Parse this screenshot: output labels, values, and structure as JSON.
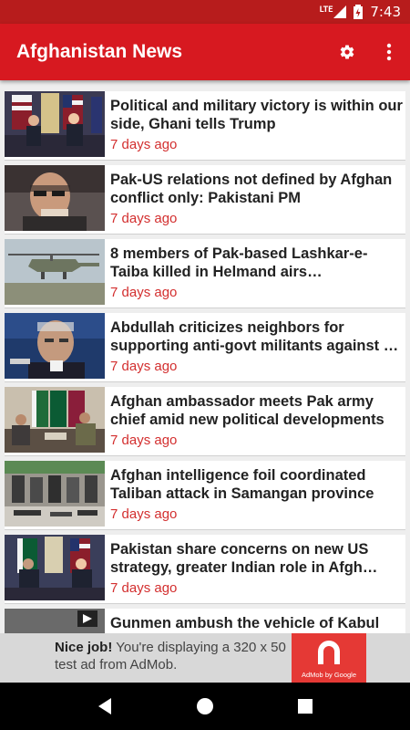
{
  "status_bar": {
    "network": "LTE",
    "time": "7:43"
  },
  "app_bar": {
    "title": "Afghanistan News",
    "settings_icon": "gear-icon",
    "menu_icon": "more-vert-icon"
  },
  "articles": [
    {
      "headline": "Political and military victory is within our side, Ghani tells Trump",
      "age": "7 days ago"
    },
    {
      "headline": "Pak-US relations not defined by Afghan conflict only: Pakistani PM",
      "age": "7 days ago"
    },
    {
      "headline": "8 members of Pak-based Lashkar-e-Taiba killed in Helmand airs…",
      "age": "7 days ago"
    },
    {
      "headline": "Abdullah criticizes neighbors for supporting anti-govt militants against …",
      "age": "7 days ago"
    },
    {
      "headline": "Afghan ambassador meets Pak army chief amid new political developments",
      "age": "7 days ago"
    },
    {
      "headline": "Afghan intelligence foil coordinated Taliban attack in Samangan province",
      "age": "7 days ago"
    },
    {
      "headline": "Pakistan share concerns on new US strategy, greater Indian role in Afgh…",
      "age": "7 days ago"
    },
    {
      "headline": "Gunmen ambush the vehicle of Kabul",
      "age": ""
    }
  ],
  "ad": {
    "bold": "Nice job!",
    "text": " You're displaying a 320 x 50 test ad from AdMob.",
    "logo_label": "AdMob by Google"
  },
  "colors": {
    "primary": "#d71920",
    "status": "#b71c1c",
    "accent_text": "#d32f2f"
  }
}
